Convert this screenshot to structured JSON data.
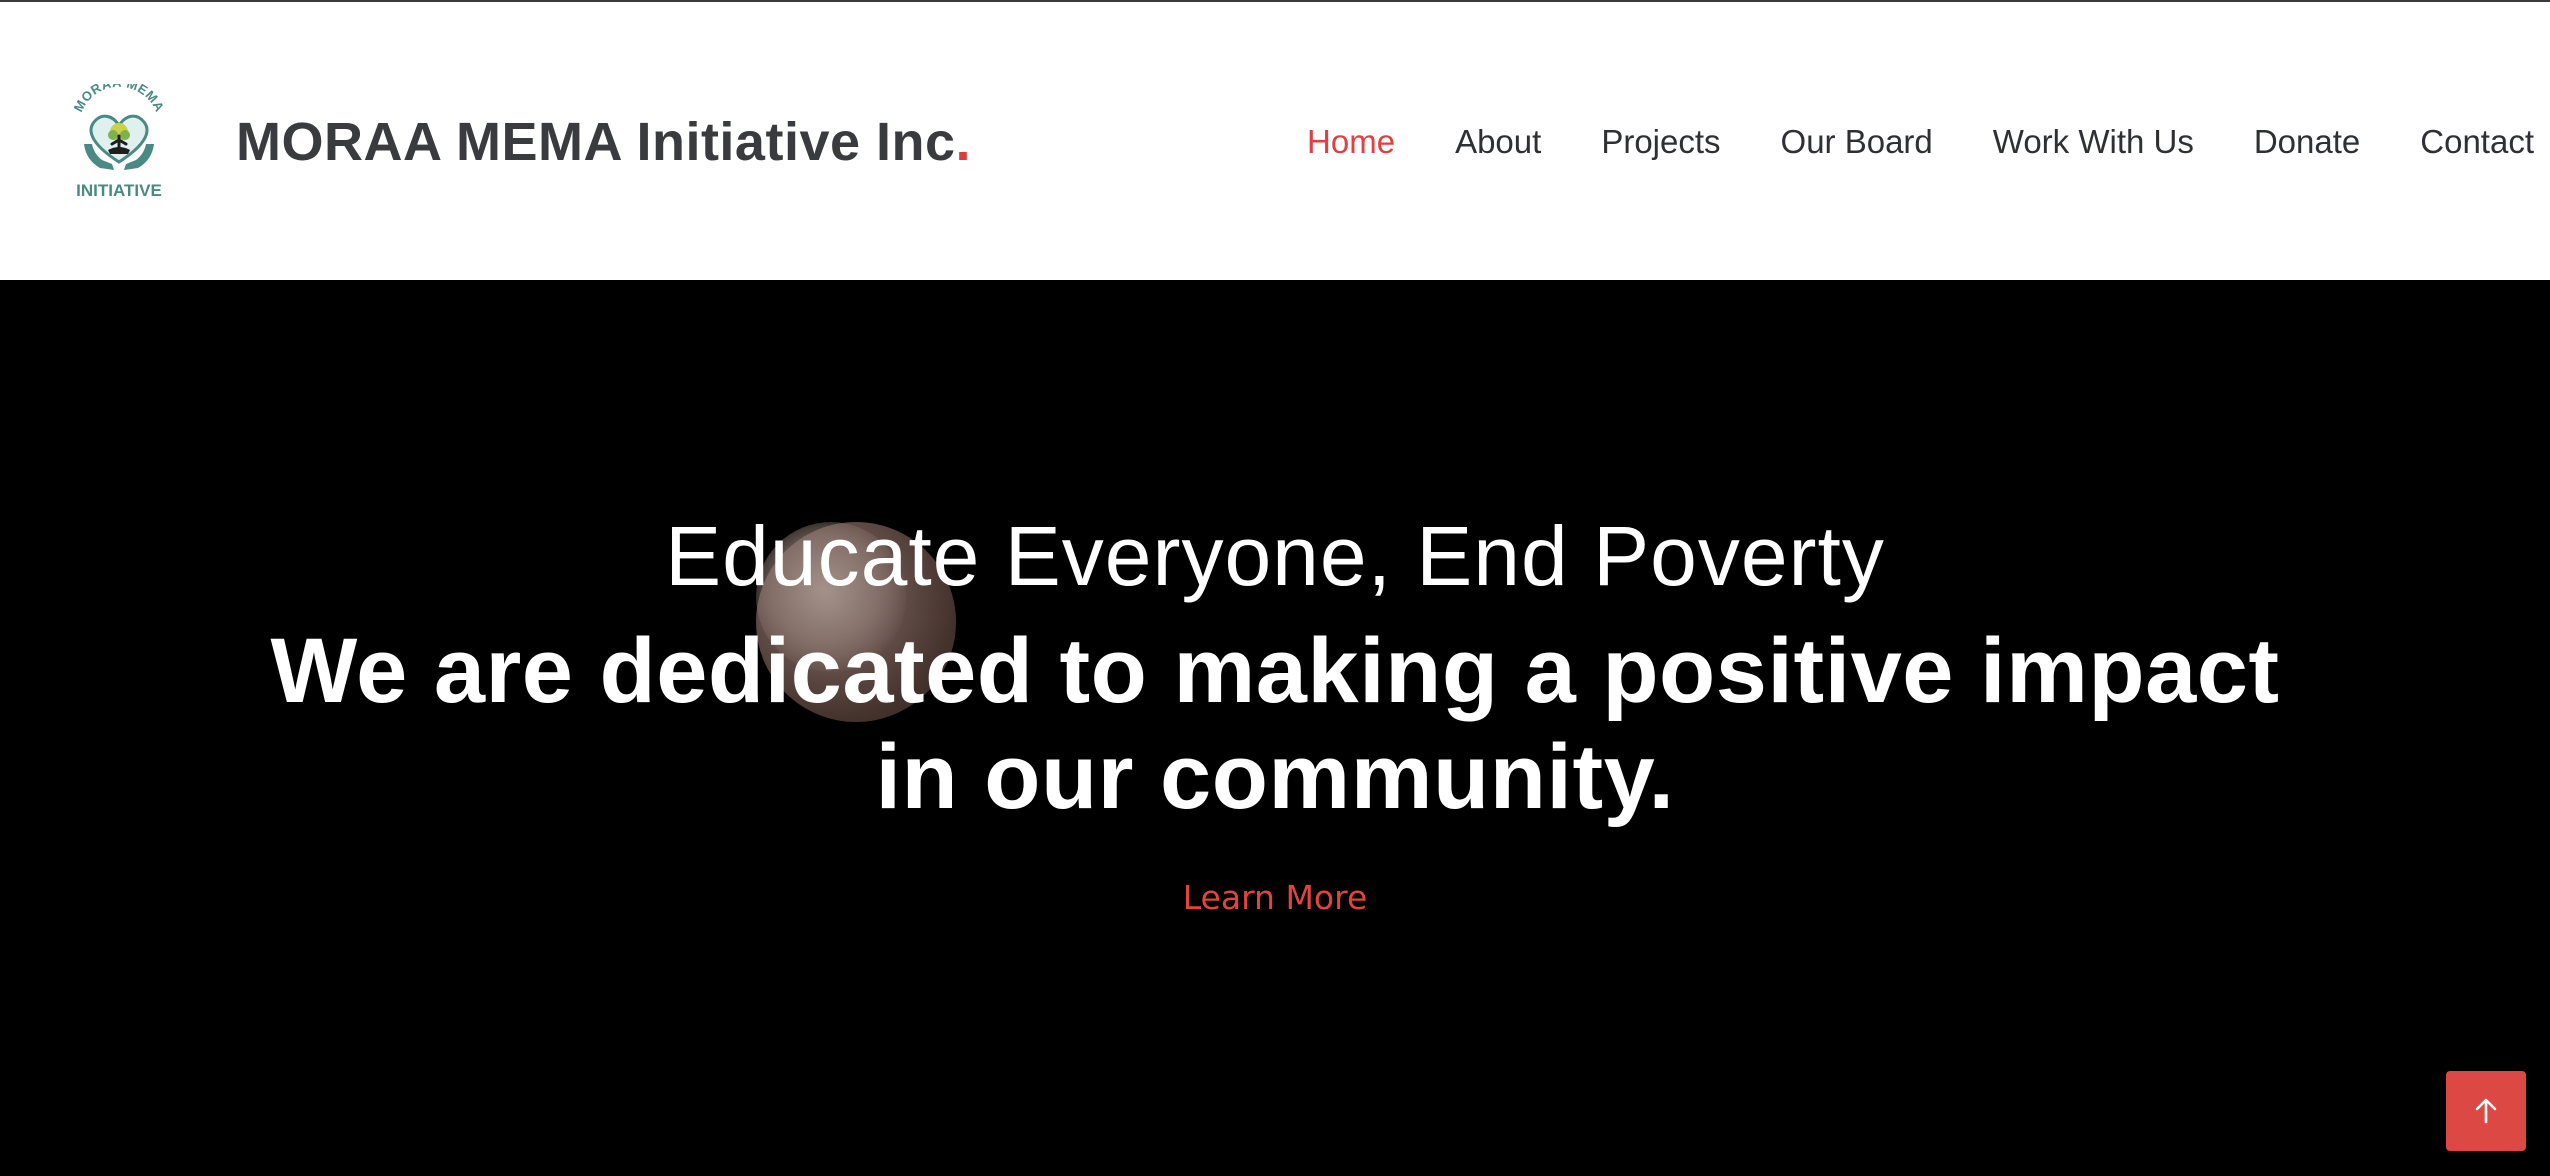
{
  "header": {
    "logo": {
      "icon": "heart-hands-logo-icon",
      "top_text": "MORAA MEMA",
      "bottom_text": "INITIATIVE",
      "color": "#4a8a85"
    },
    "brand_name": "MORAA MEMA Initiative Inc",
    "brand_dot": "."
  },
  "nav": {
    "items": [
      {
        "label": "Home",
        "active": true
      },
      {
        "label": "About",
        "active": false
      },
      {
        "label": "Projects",
        "active": false
      },
      {
        "label": "Our Board",
        "active": false
      },
      {
        "label": "Work With Us",
        "active": false
      },
      {
        "label": "Donate",
        "active": false
      },
      {
        "label": "Contact",
        "active": false
      }
    ]
  },
  "hero": {
    "subtitle": "Educate Everyone, End Poverty",
    "title_line1": "We are dedicated to making a positive impact",
    "title_line2": "in our community.",
    "cta_label": "Learn More"
  },
  "back_to_top": {
    "icon": "arrow-up-icon"
  },
  "colors": {
    "accent": "#e0403f",
    "hero_bg": "#000000",
    "text_dark": "#2f3033",
    "logo_teal": "#4a8a85"
  }
}
